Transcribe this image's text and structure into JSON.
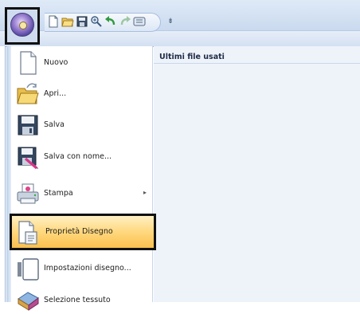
{
  "app_menu": {
    "orb_icon": "application-orb-icon",
    "items": [
      {
        "label": "Nuovo",
        "icon": "new-document-icon"
      },
      {
        "label": "Apri...",
        "icon": "open-folder-icon"
      },
      {
        "label": "Salva",
        "icon": "save-floppy-icon"
      },
      {
        "label": "Salva con nome...",
        "icon": "save-as-icon"
      },
      {
        "label": "Stampa",
        "icon": "print-icon",
        "submenu_arrow": "▸"
      },
      {
        "label": "Proprietà Disegno",
        "icon": "design-properties-icon"
      },
      {
        "label": "Impostazioni disegno...",
        "icon": "design-settings-icon"
      },
      {
        "label": "Selezione tessuto",
        "icon": "fabric-selection-icon"
      }
    ],
    "recent_header": "Ultimi file usati"
  },
  "quick_access": {
    "buttons": [
      "new-icon",
      "open-icon",
      "save-icon",
      "zoom-icon",
      "undo-icon",
      "redo-icon",
      "view-icon"
    ],
    "customize_glyph": "⇟"
  },
  "colors": {
    "highlight_top": "#fff0c4",
    "highlight_bottom": "#fbc04e",
    "panel_blue": "#eef3fa",
    "frame_black": "#111111"
  }
}
